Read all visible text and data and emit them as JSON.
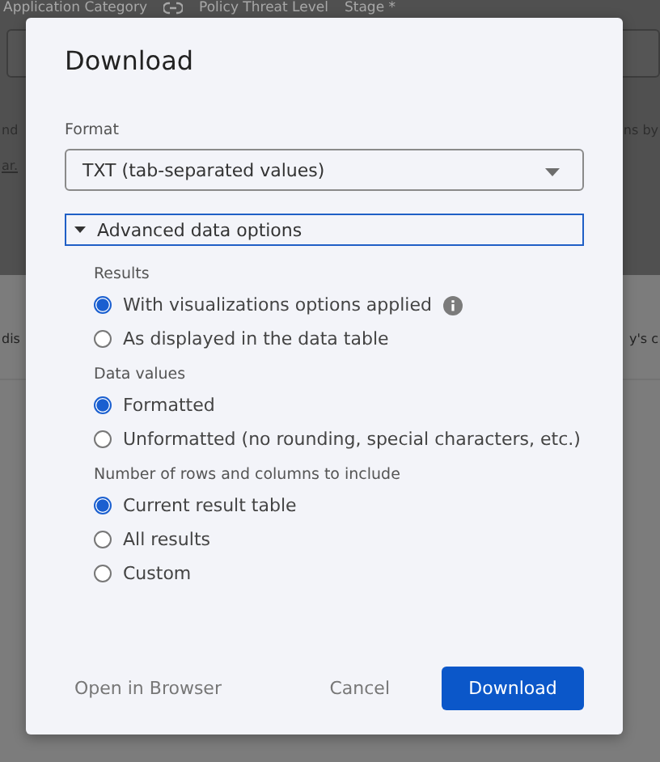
{
  "background": {
    "header_labels": [
      "Application Category",
      "Policy Threat Level",
      "Stage *"
    ],
    "text_rows": [
      {
        "left": "nd",
        "right": "ns by",
        "left_link": false
      },
      {
        "left": "ar.",
        "right": "",
        "left_link": true
      },
      {
        "left": "dis",
        "right": "y's c",
        "left_link": false
      }
    ]
  },
  "dialog": {
    "title": "Download",
    "format": {
      "label": "Format",
      "value": "TXT (tab-separated values)"
    },
    "advanced": {
      "label": "Advanced data options",
      "expanded": true
    },
    "groups": [
      {
        "label": "Results",
        "options": [
          {
            "label": "With visualizations options applied",
            "selected": true,
            "info": true
          },
          {
            "label": "As displayed in the data table",
            "selected": false,
            "info": false
          }
        ]
      },
      {
        "label": "Data values",
        "options": [
          {
            "label": "Formatted",
            "selected": true,
            "info": false
          },
          {
            "label": "Unformatted (no rounding, special characters, etc.)",
            "selected": false,
            "info": false
          }
        ]
      },
      {
        "label": "Number of rows and columns to include",
        "options": [
          {
            "label": "Current result table",
            "selected": true,
            "info": false
          },
          {
            "label": "All results",
            "selected": false,
            "info": false
          },
          {
            "label": "Custom",
            "selected": false,
            "info": false
          }
        ]
      }
    ],
    "buttons": [
      {
        "label": "Open in Browser",
        "kind": "link"
      },
      {
        "label": "Cancel",
        "kind": "link"
      },
      {
        "label": "Download",
        "kind": "primary"
      }
    ]
  }
}
